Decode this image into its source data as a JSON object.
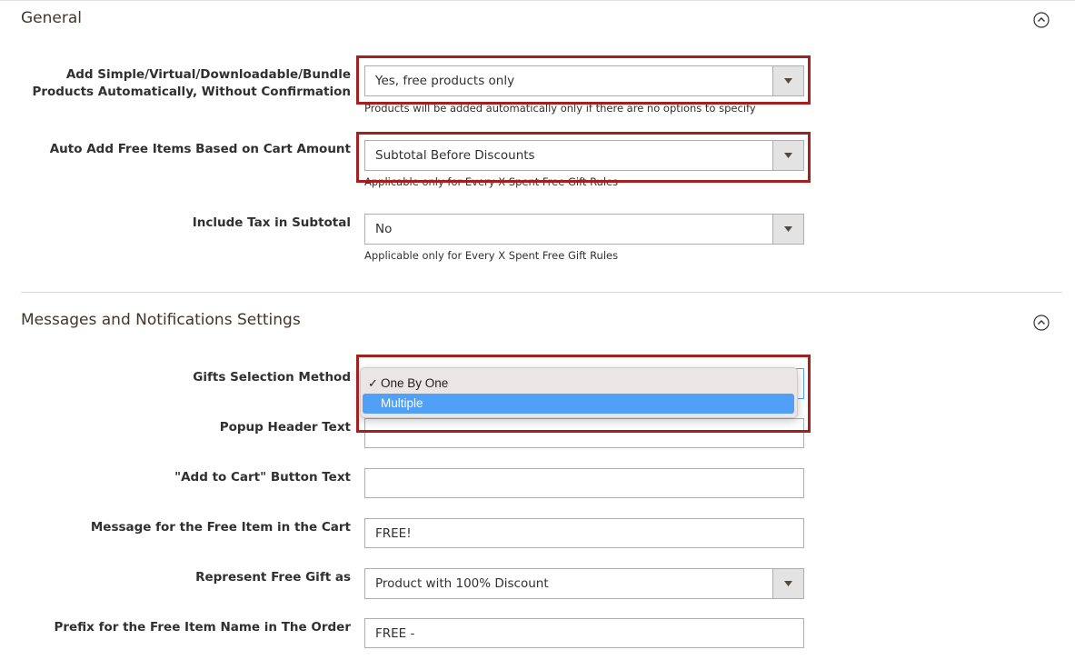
{
  "general": {
    "title": "General",
    "collapse_icon": "chevron-up-circle-icon",
    "fields": {
      "auto_add": {
        "label": "Add Simple/Virtual/Downloadable/Bundle Products Automatically, Without Confirmation",
        "value": "Yes, free products only",
        "note": "Products will be added automatically only if there are no options to specify"
      },
      "cart_amount": {
        "label": "Auto Add Free Items Based on Cart Amount",
        "value": "Subtotal Before Discounts",
        "note": "Applicable only for Every X Spent Free Gift Rules"
      },
      "include_tax": {
        "label": "Include Tax in Subtotal",
        "value": "No",
        "note": "Applicable only for Every X Spent Free Gift Rules"
      }
    }
  },
  "messages": {
    "title": "Messages and Notifications Settings",
    "collapse_icon": "chevron-up-circle-icon",
    "fields": {
      "gifts_method": {
        "label": "Gifts Selection Method",
        "options": [
          {
            "label": "One By One",
            "selected": true
          },
          {
            "label": "Multiple",
            "highlighted": true
          }
        ],
        "check_mark": "✓"
      },
      "popup_header": {
        "label": "Popup Header Text",
        "value": ""
      },
      "add_to_cart": {
        "label": "\"Add to Cart\" Button Text",
        "value": ""
      },
      "free_message": {
        "label": "Message for the Free Item in the Cart",
        "value": "FREE!"
      },
      "represent_as": {
        "label": "Represent Free Gift as",
        "value": "Product with 100% Discount"
      },
      "prefix": {
        "label": "Prefix for the Free Item Name in The Order",
        "value": "FREE -"
      }
    }
  },
  "colors": {
    "highlight_border": "#a51f1f",
    "dropdown_highlight": "#4fa0f6"
  }
}
